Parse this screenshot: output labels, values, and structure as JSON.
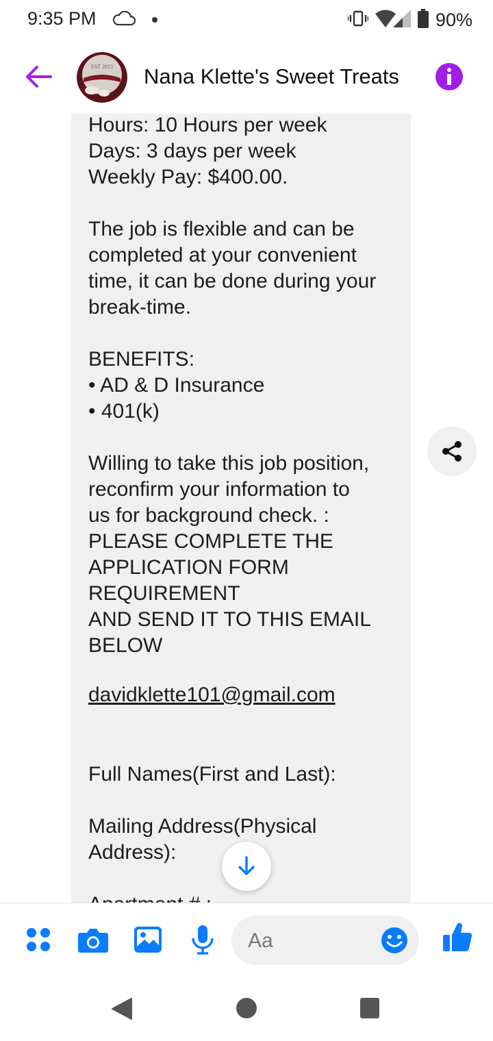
{
  "status_bar": {
    "time": "9:35 PM",
    "battery_percent": "90%",
    "icons": [
      "cloud-icon",
      "vibrate-icon",
      "wifi-icon",
      "signal-icon",
      "battery-icon"
    ]
  },
  "header": {
    "title": "Nana Klette's Sweet Treats",
    "avatar_text": "EST 2013",
    "icons": [
      "back-arrow-icon",
      "info-icon"
    ]
  },
  "message": {
    "lines": [
      "Hours: 10 Hours per week",
      "Days: 3 days per week",
      "Weekly Pay: $400.00.",
      "",
      "The job is flexible and can be",
      "completed at your convenient",
      "time, it can be done during your",
      "break-time.",
      "",
      "BENEFITS:",
      "• AD & D Insurance",
      "• 401(k)",
      "",
      "Willing to take this job position,",
      "reconfirm your information to",
      "us for background check. :",
      "PLEASE COMPLETE THE",
      "APPLICATION FORM",
      "REQUIREMENT",
      "AND SEND IT TO THIS EMAIL",
      "BELOW"
    ],
    "email": "davidklette101@gmail.com",
    "form_lines": [
      "Full Names(First and Last):",
      "",
      "Mailing Address(Physical",
      "Address):",
      "",
      "Apartment # :"
    ]
  },
  "composer": {
    "placeholder": "Aa",
    "icons": [
      "menu-dots-icon",
      "camera-icon",
      "gallery-icon",
      "microphone-icon",
      "emoji-icon",
      "thumbs-up-icon"
    ]
  },
  "floating": {
    "icons": [
      "share-icon",
      "arrow-down-icon"
    ]
  },
  "nav_bar": {
    "icons": [
      "nav-back-icon",
      "nav-home-icon",
      "nav-recents-icon"
    ]
  },
  "colors": {
    "accent_purple": "#a21de6",
    "messenger_blue": "#0a7cff",
    "bubble_gray": "#f0f0f0"
  }
}
